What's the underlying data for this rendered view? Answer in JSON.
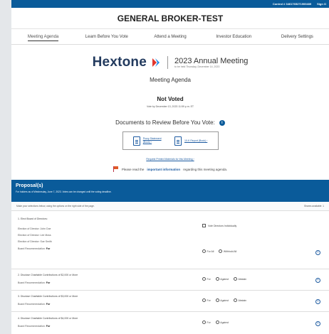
{
  "topbar": {
    "control": "Control # 3461765271900489",
    "signout": "Sign O"
  },
  "broker_title": "GENERAL BROKER-TEST",
  "nav": [
    {
      "label": "Meeting Agenda"
    },
    {
      "label": "Learn Before You Vote"
    },
    {
      "label": "Attend a Meeting"
    },
    {
      "label": "Investor Education"
    },
    {
      "label": "Delivery Settings"
    }
  ],
  "company": {
    "logo_text": "Hextone",
    "meeting_title": "2023 Annual Meeting",
    "meeting_sub": "to be held Thursday, December 14, 2023",
    "colors": {
      "logo_text": "#223a5e",
      "mark_red": "#e2362d",
      "mark_blue": "#1e88e5"
    }
  },
  "agenda_title": "Meeting Agenda",
  "status": {
    "label": "Not Voted",
    "vote_by": "Vote by December 13, 2023 11:59 p.m. ET"
  },
  "documents": {
    "title": "Documents to Review Before You Vote:",
    "info_icon": "info-icon",
    "items": [
      {
        "line1": "Proxy Statement",
        "line2": "(Book) ›",
        "icon": "document-icon"
      },
      {
        "line1": "10-K Report (Book) ›",
        "line2": "",
        "icon": "document-icon"
      }
    ],
    "request_link": "Request Printed Materials for this Meeting ›"
  },
  "notice": {
    "prefix": "Please read the",
    "link": "important information",
    "suffix": "regarding this meeting agenda.",
    "icon": "flag-icon"
  },
  "proposals": {
    "title": "Proposal(s)",
    "subtitle": "For holders as of Wednesday, June 7, 2023. Votes can be changed until the voting deadline.",
    "instructions": "Make your selections below, using the options on the right side of the page.",
    "shares_label": "Shares available:",
    "shares_value": "1",
    "rec_label": "Board Recommendation:",
    "items": [
      {
        "title": "1. Elect Board of Directors:",
        "directors": [
          "Election of Director: John Doe",
          "Election of Director: Lee Moss",
          "Election of Director: Sue Smith"
        ],
        "recommendation": "For",
        "checkbox_label": "Vote Directors Individually",
        "options": [
          "For All",
          "Withhold All"
        ]
      },
      {
        "title": "2. Disclose Charitable Contributions of $2,000 or More",
        "recommendation": "For",
        "options": [
          "For",
          "Against",
          "Abstain"
        ]
      },
      {
        "title": "3. Disclose Charitable Contributions of $3,000 or More",
        "recommendation": "For",
        "options": [
          "For",
          "Against",
          "Abstain"
        ]
      },
      {
        "title": "4. Disclose Charitable Contributions of $4,000 or More",
        "recommendation": "For",
        "options": [
          "For",
          "Against"
        ]
      }
    ],
    "clear_icon": "clear-selection-icon",
    "accent_color": "#0a5b9a"
  }
}
